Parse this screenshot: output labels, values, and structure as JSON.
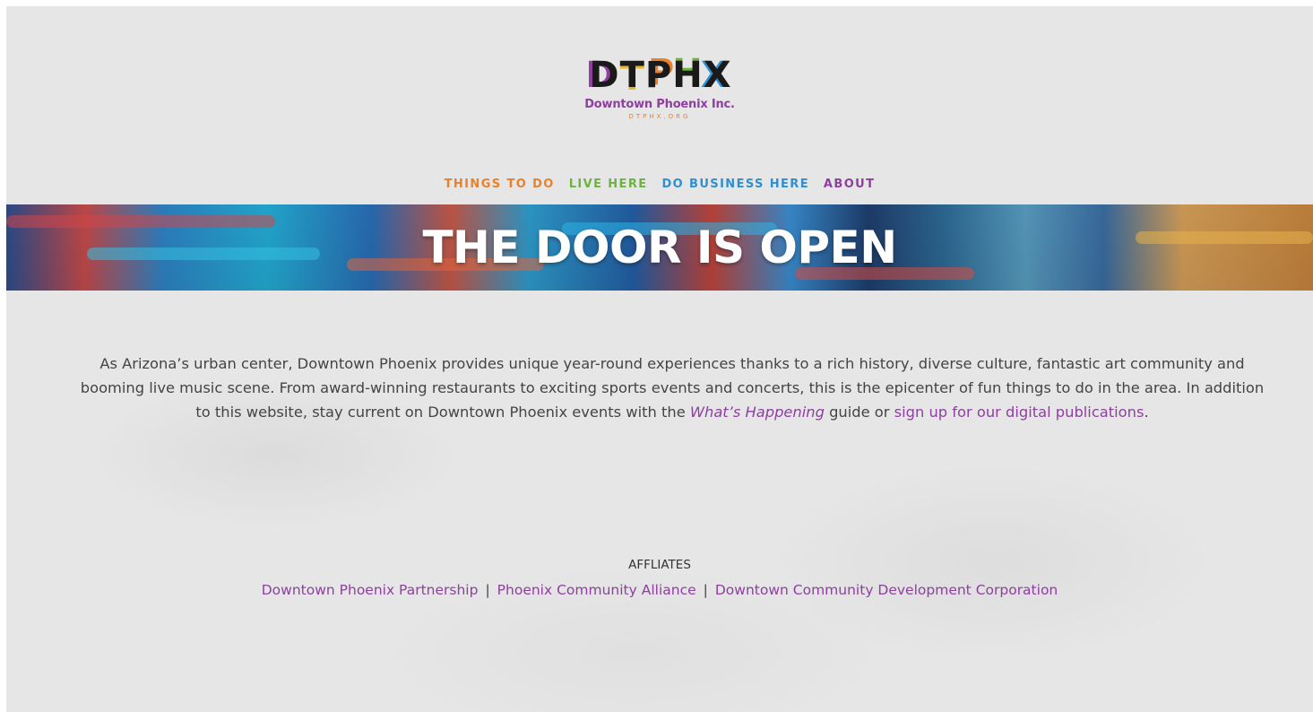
{
  "brand": {
    "logo_letters": [
      "D",
      "T",
      "P",
      "H",
      "X"
    ],
    "name": "Downtown Phoenix Inc.",
    "url": "DTPHX.ORG"
  },
  "nav": {
    "items": [
      {
        "label": "THINGS TO DO",
        "color": "#e8812a"
      },
      {
        "label": "LIVE HERE",
        "color": "#6db33f"
      },
      {
        "label": "DO BUSINESS HERE",
        "color": "#2f8fd0"
      },
      {
        "label": "ABOUT",
        "color": "#8e3fa0"
      }
    ]
  },
  "hero": {
    "title": "THE DOOR IS OPEN"
  },
  "intro": {
    "text_1": "As Arizona’s urban center, Downtown Phoenix provides unique year-round experiences thanks to a rich history, diverse culture, fantastic art community and booming live music scene. From award-winning restaurants to exciting sports events and concerts, this is the epicenter of fun things to do in the area. In addition to this website, stay current on Downtown Phoenix events with the ",
    "guide_link": "What’s Happening",
    "text_2": " guide or ",
    "signup_link": "sign up for our digital publications",
    "text_3": "."
  },
  "affiliates": {
    "title": "AFFLIATES",
    "links": [
      "Downtown Phoenix Partnership",
      "Phoenix Community Alliance",
      "Downtown Community Development Corporation"
    ],
    "separator": "|"
  },
  "colors": {
    "accent_purple": "#8e3fa0",
    "accent_orange": "#e8812a",
    "accent_green": "#6db33f",
    "accent_blue": "#2f8fd0",
    "background": "#e6e6e6"
  }
}
